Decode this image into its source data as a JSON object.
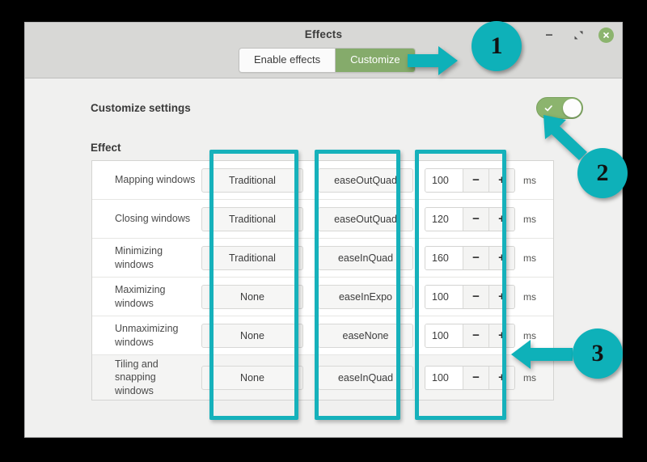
{
  "window": {
    "title": "Effects",
    "controls": {
      "minimize": "minimize",
      "maximize": "maximize",
      "close": "close"
    }
  },
  "tabs": [
    {
      "label": "Enable effects",
      "active": false
    },
    {
      "label": "Customize",
      "active": true
    }
  ],
  "settings": {
    "customize_label": "Customize settings",
    "toggle_state": "on",
    "toggle_check": "✓"
  },
  "table": {
    "heading": "Effect",
    "unit": "ms",
    "minus": "−",
    "plus": "+",
    "rows": [
      {
        "name": "Mapping windows",
        "type": "Traditional",
        "easing": "easeOutQuad",
        "duration": "100"
      },
      {
        "name": "Closing windows",
        "type": "Traditional",
        "easing": "easeOutQuad",
        "duration": "120"
      },
      {
        "name": "Minimizing windows",
        "type": "Traditional",
        "easing": "easeInQuad",
        "duration": "160"
      },
      {
        "name": "Maximizing windows",
        "type": "None",
        "easing": "easeInExpo",
        "duration": "100"
      },
      {
        "name": "Unmaximizing windows",
        "type": "None",
        "easing": "easeNone",
        "duration": "100"
      },
      {
        "name": "Tiling and snapping windows",
        "type": "None",
        "easing": "easeInQuad",
        "duration": "100"
      }
    ]
  },
  "annotations": {
    "badges": [
      {
        "number": "1"
      },
      {
        "number": "2"
      },
      {
        "number": "3"
      }
    ],
    "accent_color": "#0eb1b9",
    "highlight_color": "#16b1bb"
  },
  "colors": {
    "tab_active_bg": "#85ab6b",
    "toggle_on_bg": "#8cb46e",
    "close_button_bg": "#8cb46e",
    "titlebar_bg": "#d8d8d6",
    "content_bg": "#f0f0ef",
    "backdrop": "#000000"
  }
}
